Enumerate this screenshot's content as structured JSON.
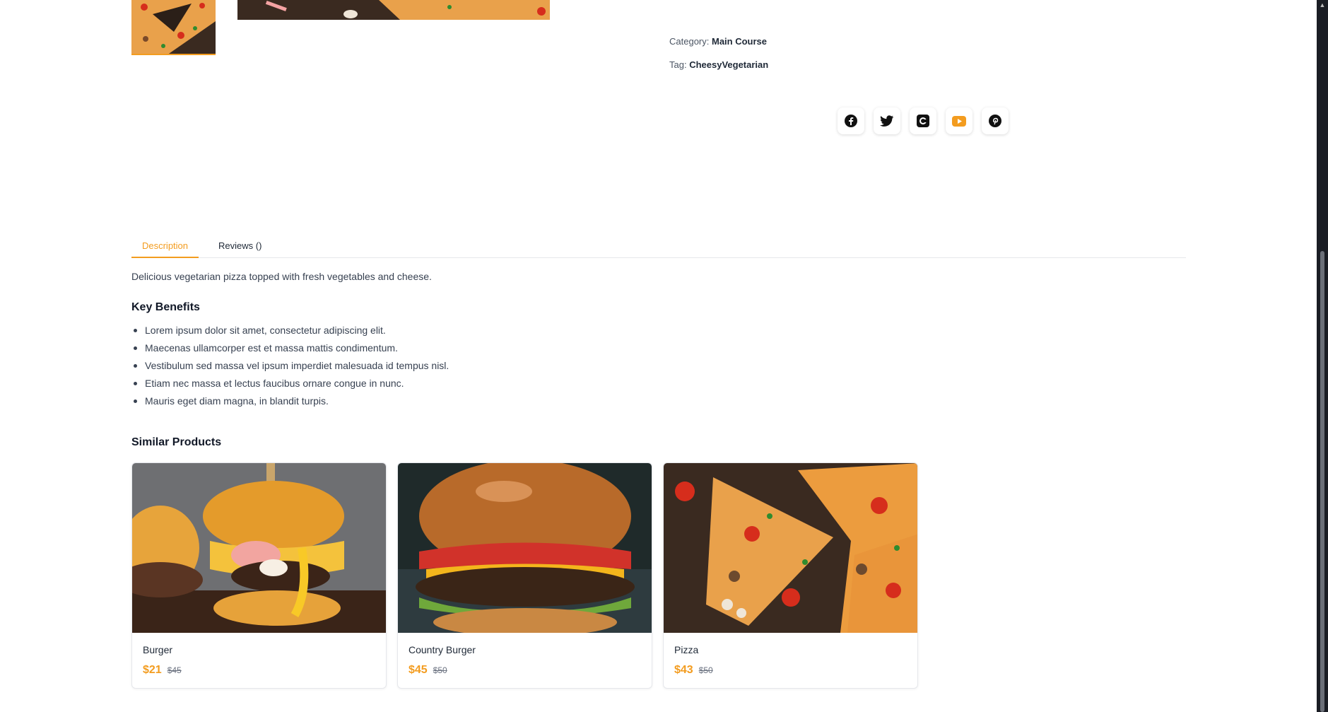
{
  "product_meta": {
    "category_label": "Category:",
    "category_value": "Main Course",
    "tag_label": "Tag:",
    "tag_value": "CheesyVegetarian"
  },
  "social": {
    "icons": [
      "facebook-icon",
      "twitter-icon",
      "instagram-icon",
      "youtube-icon",
      "pinterest-icon"
    ],
    "accent": "#f39c1f"
  },
  "tabs": [
    {
      "label": "Description",
      "active": true
    },
    {
      "label": "Reviews ()",
      "active": false
    }
  ],
  "description": {
    "text": "Delicious vegetarian pizza topped with fresh vegetables and cheese.",
    "benefits_heading": "Key Benefits",
    "benefits": [
      "Lorem ipsum dolor sit amet, consectetur adipiscing elit.",
      "Maecenas ullamcorper est et massa mattis condimentum.",
      "Vestibulum sed massa vel ipsum imperdiet malesuada id tempus nisl.",
      "Etiam nec massa et lectus faucibus ornare congue in nunc.",
      "Mauris eget diam magna, in blandit turpis."
    ]
  },
  "similar": {
    "heading": "Similar Products",
    "products": [
      {
        "name": "Burger",
        "price": "$21",
        "old_price": "$45"
      },
      {
        "name": "Country Burger",
        "price": "$45",
        "old_price": "$50"
      },
      {
        "name": "Pizza",
        "price": "$43",
        "old_price": "$50"
      }
    ]
  },
  "colors": {
    "accent": "#f39c1f",
    "text": "#1f2937",
    "sidebar": "#1a1d24"
  }
}
